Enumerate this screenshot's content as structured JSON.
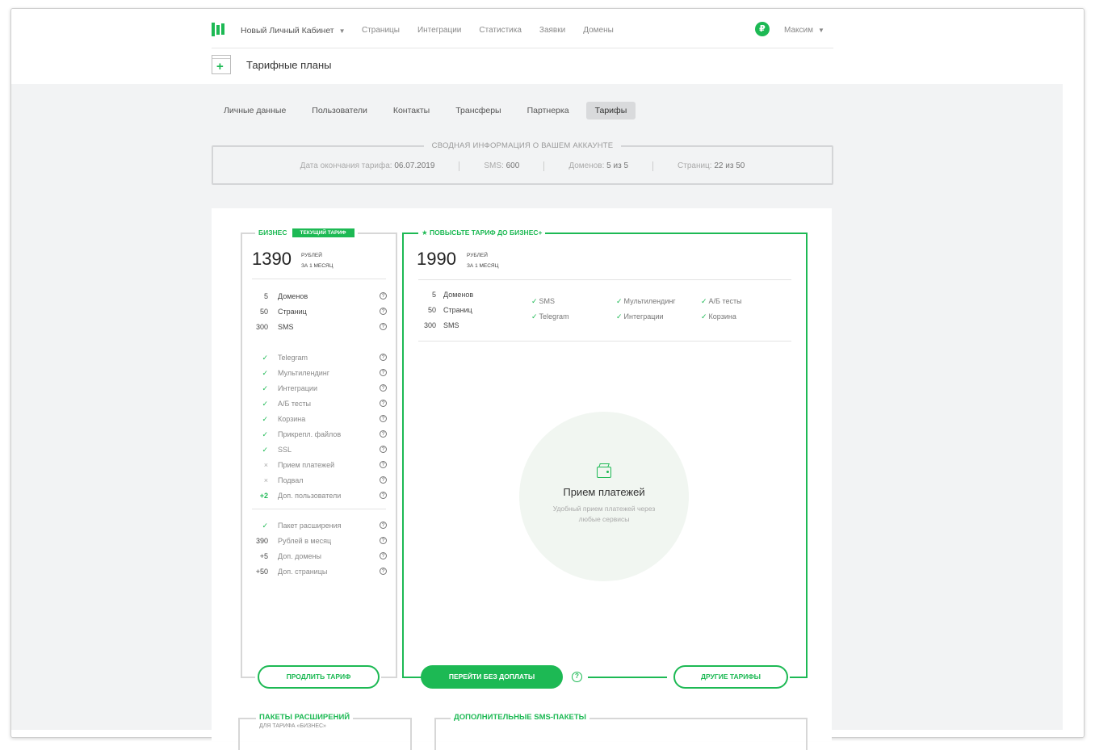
{
  "header": {
    "app_title": "Новый Личный Кабинет",
    "nav": [
      "Страницы",
      "Интеграции",
      "Статистика",
      "Заявки",
      "Домены"
    ],
    "currency_symbol": "₽",
    "user_name": "Максим",
    "caret": "▼"
  },
  "page": {
    "title": "Тарифные планы"
  },
  "tabs": [
    {
      "label": "Личные данные",
      "active": false
    },
    {
      "label": "Пользователи",
      "active": false
    },
    {
      "label": "Контакты",
      "active": false
    },
    {
      "label": "Трансферы",
      "active": false
    },
    {
      "label": "Партнерка",
      "active": false
    },
    {
      "label": "Тарифы",
      "active": true
    }
  ],
  "summary": {
    "title": "СВОДНАЯ ИНФОРМАЦИЯ О ВАШЕМ АККАУНТЕ",
    "end_label": "Дата окончания тарифа:",
    "end_value": "06.07.2019",
    "sms_label": "SMS:",
    "sms_value": "600",
    "domains_label": "Доменов:",
    "domains_value": "5 из 5",
    "pages_label": "Страниц:",
    "pages_value": "22 из 50"
  },
  "current_plan": {
    "name": "БИЗНЕС",
    "badge": "ТЕКУЩИЙ ТАРИФ",
    "price": "1390",
    "unit_1": "РУБЛЕЙ",
    "unit_2": "ЗА 1 МЕСЯЦ",
    "limits": [
      {
        "num": "5",
        "label": "Доменов"
      },
      {
        "num": "50",
        "label": "Страниц"
      },
      {
        "num": "300",
        "label": "SMS"
      }
    ],
    "features": [
      {
        "mark": "✓",
        "label": "Telegram",
        "enabled": true
      },
      {
        "mark": "✓",
        "label": "Мультилендинг",
        "enabled": true
      },
      {
        "mark": "✓",
        "label": "Интеграции",
        "enabled": true
      },
      {
        "mark": "✓",
        "label": "А/Б тесты",
        "enabled": true
      },
      {
        "mark": "✓",
        "label": "Корзина",
        "enabled": true
      },
      {
        "mark": "✓",
        "label": "Прикрепл. файлов",
        "enabled": true
      },
      {
        "mark": "✓",
        "label": "SSL",
        "enabled": true
      },
      {
        "mark": "×",
        "label": "Прием платежей",
        "enabled": false
      },
      {
        "mark": "×",
        "label": "Подвал",
        "enabled": false
      },
      {
        "mark": "+2",
        "label": "Доп. пользователи",
        "enabled": true
      }
    ],
    "extras": [
      {
        "mark": "✓",
        "label": "Пакет расширения",
        "type": "check"
      },
      {
        "mark": "390",
        "label": "Рублей в месяц",
        "type": "num"
      },
      {
        "mark": "+5",
        "label": "Доп. домены",
        "type": "num"
      },
      {
        "mark": "+50",
        "label": "Доп. страницы",
        "type": "num"
      }
    ],
    "renew_button": "ПРОДЛИТЬ ТАРИФ"
  },
  "upgrade_plan": {
    "title": "ПОВЫСЬТЕ ТАРИФ ДО БИЗНЕС+",
    "star": "★",
    "price": "1990",
    "unit_1": "РУБЛЕЙ",
    "unit_2": "ЗА 1 МЕСЯЦ",
    "limits": [
      {
        "num": "5",
        "label": "Доменов"
      },
      {
        "num": "50",
        "label": "Страниц"
      },
      {
        "num": "300",
        "label": "SMS"
      }
    ],
    "checks": [
      "SMS",
      "Мультилендинг",
      "А/Б тесты",
      "Telegram",
      "Интеграции",
      "Корзина"
    ],
    "check_mark": "✓",
    "promo_title": "Прием платежей",
    "promo_desc": "Удобный прием платежей через любые сервисы",
    "go_button": "ПЕРЕЙТИ БЕЗ ДОПЛАТЫ",
    "other_button": "ДРУГИЕ ТАРИФЫ",
    "help": "?"
  },
  "packages": {
    "ext_title": "ПАКЕТЫ РАСШИРЕНИЙ",
    "ext_sub": "ДЛЯ ТАРИФА «БИЗНЕС»",
    "sms_title": "ДОПОЛНИТЕЛЬНЫЕ SMS-ПАКЕТЫ"
  },
  "colors": {
    "accent": "#1db954",
    "background": "#f2f3f4"
  }
}
